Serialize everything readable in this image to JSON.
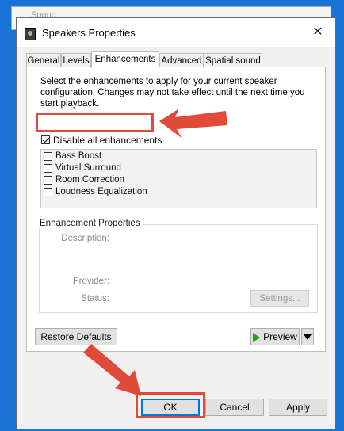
{
  "background_window": {
    "title": "Sound"
  },
  "window": {
    "title": "Speakers Properties",
    "close_glyph": "✕"
  },
  "tabs": [
    {
      "label": "General"
    },
    {
      "label": "Levels"
    },
    {
      "label": "Enhancements",
      "active": true
    },
    {
      "label": "Advanced"
    },
    {
      "label": "Spatial sound"
    }
  ],
  "enhancements": {
    "instructions": "Select the enhancements to apply for your current speaker configuration. Changes may not take effect until the next time you start playback.",
    "disable_all": {
      "label": "Disable all enhancements",
      "checked": true
    },
    "items": [
      {
        "label": "Bass Boost",
        "checked": false
      },
      {
        "label": "Virtual Surround",
        "checked": false
      },
      {
        "label": "Room Correction",
        "checked": false
      },
      {
        "label": "Loudness Equalization",
        "checked": false
      }
    ]
  },
  "properties": {
    "group_title": "Enhancement Properties",
    "description_label": "Description:",
    "provider_label": "Provider:",
    "status_label": "Status:",
    "settings_button": "Settings..."
  },
  "buttons": {
    "restore_defaults": "Restore Defaults",
    "preview": "Preview",
    "ok": "OK",
    "cancel": "Cancel",
    "apply": "Apply"
  },
  "colors": {
    "annotation": "#e04a3b",
    "desktop": "#1a74d6",
    "play_icon": "#1ea31e"
  },
  "icons": {
    "window": "speaker-icon",
    "close": "close-icon",
    "preview": "play-icon",
    "dropdown": "chevron-down-icon"
  }
}
